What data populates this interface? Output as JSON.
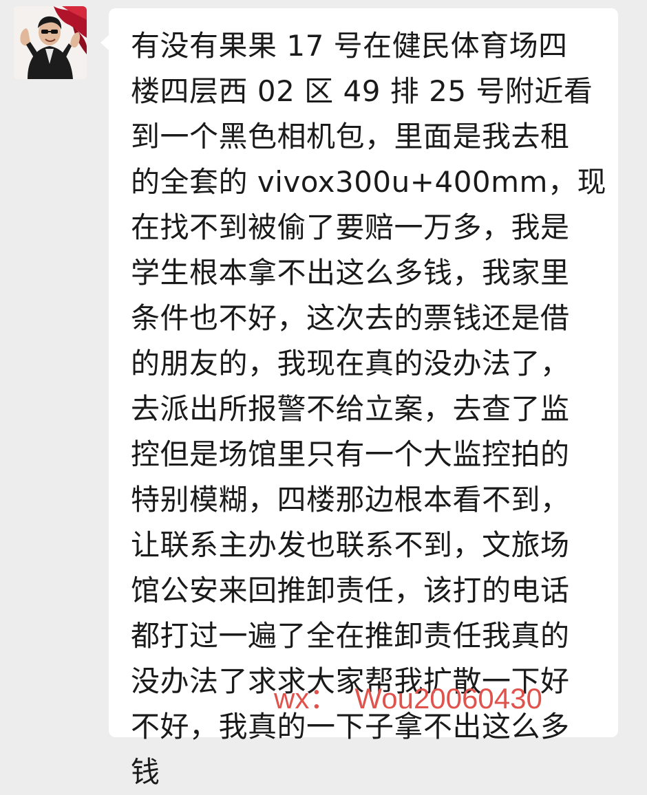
{
  "chat": {
    "message_lines": [
      "有没有果果 17 号在健民体育场四",
      "楼四层西 02 区 49 排 25 号附近看",
      "到一个黑色相机包，里面是我去租",
      "的全套的 vivox300u+400mm，现",
      "在找不到被偷了要赔一万多，我是",
      "学生根本拿不出这么多钱，我家里",
      "条件也不好，这次去的票钱还是借",
      "的朋友的，我现在真的没办法了，",
      "去派出所报警不给立案，去查了监",
      "控但是场馆里只有一个大监控拍的",
      "特别模糊，四楼那边根本看不到，",
      "让联系主办发也联系不到，文旅场",
      "馆公安来回推卸责任，该打的电话",
      "都打过一遍了全在推卸责任我真的",
      "没办法了求求大家帮我扩散一下好",
      "不好，我真的一下子拿不出这么多",
      "钱"
    ],
    "contact_label": "wx：",
    "contact_id": "Wou20060430",
    "contact_color": "#e0534d",
    "bubble_color": "#ffffff",
    "background_color": "#ededed"
  }
}
